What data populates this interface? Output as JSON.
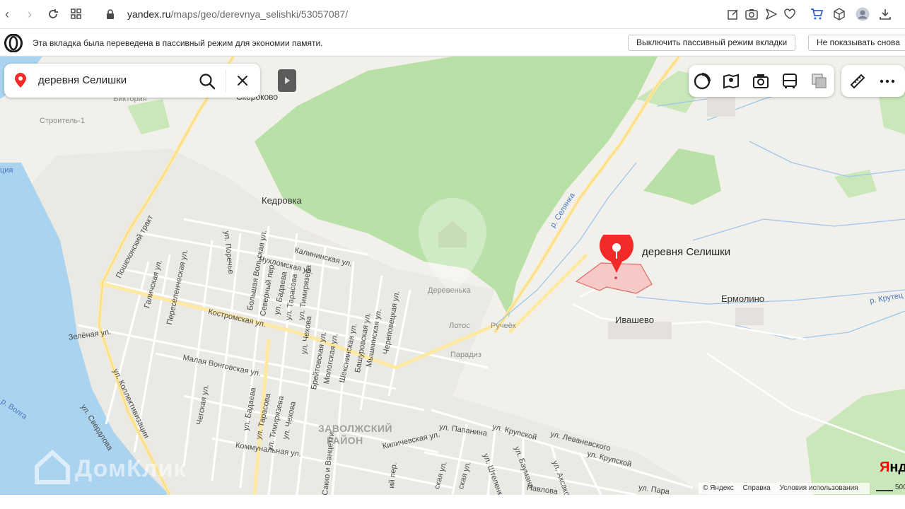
{
  "browser": {
    "url_host": "yandex.ru",
    "url_path": "/maps/geo/derevnya_selishki/53057087/"
  },
  "info_bar": {
    "message": "Эта вкладка была переведена в пассивный режим для экономии памяти.",
    "disable_button": "Выключить пассивный режим вкладки",
    "dismiss_button": "Не показывать снова"
  },
  "search": {
    "value": "деревня Селишки"
  },
  "map": {
    "marker_label": "деревня Селишки",
    "places": {
      "kedrovka": "Кедровка",
      "ermolino": "Ермолино",
      "ivashevo": "Ивашево",
      "skorokovo": "Скороково",
      "viktoriya": "Виктория",
      "stroitel": "Строитель-1",
      "derevenka": "Деревенька",
      "lotos": "Лотос",
      "ruchyok": "Ручеёк",
      "paradiz": "Парадиз",
      "district_line1": "ЗАВОЛЖСКИЙ",
      "district_line2": "РАЙОН",
      "selyanka": "р. Селянка",
      "krutets": "р. Крутец",
      "volga": "р. Волга",
      "edge_label": "ция"
    },
    "streets": {
      "poshekhonsky": "Пошехонский тракт",
      "kostromskaya": "Костромская ул.",
      "malaya_vongovskaya": "Малая Вонговская ул.",
      "zelenaya": "Зелёная ул.",
      "kollektivizatsii": "ул. Коллективизации",
      "sverdlova": "ул. Свердлова",
      "kalininskaya": "Калининская ул.",
      "chukhlomskaya": "Чухломская ул.",
      "galichskaya": "Галичская ул.",
      "pereslavskaya": "Переселенческая ул.",
      "porechye": "ул. Поречье",
      "bolshaya_volskaya": "Большая Вольская ул.",
      "severny": "Северный пер.",
      "badaeva": "ул. Бадаева",
      "timiryazeva": "ул. Тимирязева",
      "tarasova": "ул. Тарасова",
      "chekhova": "ул. Чехова",
      "breytovskaya": "Брейтовская ул.",
      "mologskaya": "Мологская ул.",
      "sheksninskaya": "Шекснинская ул.",
      "bashurovskaya": "Башуровская ул.",
      "myshkinskaya": "Мышкинская ул.",
      "cherepovetskaya": "Череповецкая ул.",
      "chegskaya": "Чегская ул.",
      "badaeva2": "ул. Бадаева",
      "tarasova2": "ул. Тарасова",
      "timiryazeva2": "ул. Тимирязева",
      "chekhova2": "ул. Чехова",
      "kommunalnaya": "Коммунальная ул.",
      "kipichevskaya": "Кипичевская ул.",
      "papanina": "ул. Папанина",
      "krupskoy": "ул. Крупской",
      "levanevskogo": "ул. Леваневского",
      "krupskoy2": "ул. Крупской",
      "vanzetti": "Сакко и Ванцетти",
      "baumana": "ул. Баумана",
      "shtelenko": "ул. Штеленко",
      "aksakova": "ул. Аксакова",
      "pavlova": "Павлова",
      "para": "ул. Пара",
      "misc1": "ская ул.",
      "misc2": "ская ул.",
      "misc3": "ий пер."
    }
  },
  "footer": {
    "copyright": "© Яндекс",
    "help": "Справка",
    "terms": "Условия использования",
    "scale": "500",
    "logo_first": "Я",
    "logo_rest": "нд"
  },
  "watermark": {
    "text": "ДомКлик"
  },
  "colors": {
    "forest": "#b8e0a7",
    "water": "#aad3f0",
    "road": "#fde9a4",
    "marker": "#f22a2a"
  }
}
